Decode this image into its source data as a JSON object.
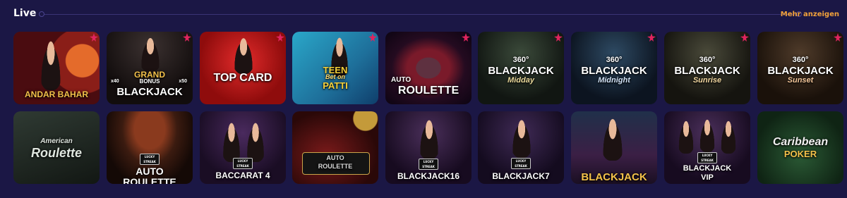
{
  "section": {
    "title": "Live",
    "more_label": "Mehr anzeigen"
  },
  "games": [
    {
      "name": "ANDAR BAHAR",
      "icon": "pin-icon",
      "style": "andar"
    },
    {
      "name": "GRAND BONUS BLACKJACK",
      "top": "GRAND",
      "mid": "BONUS",
      "bottom": "BLACKJACK",
      "mult_left": "x40",
      "mult_right": "x50",
      "style": "grand"
    },
    {
      "name": "TOP CARD",
      "style": "topcard"
    },
    {
      "name": "TEEN PATTI",
      "line1": "TEEN",
      "line2": "Bet on",
      "line3": "PATTI",
      "style": "teen"
    },
    {
      "name": "AUTO ROULETTE",
      "line1": "AUTO",
      "line2": "ROULETTE",
      "style": "autorou"
    },
    {
      "name": "360° BLACKJACK Midday",
      "deg": "360°",
      "main": "BLACKJACK",
      "sub": "Midday",
      "style": "bj1"
    },
    {
      "name": "360° BLACKJACK Midnight",
      "deg": "360°",
      "main": "BLACKJACK",
      "sub": "Midnight",
      "style": "bj2"
    },
    {
      "name": "360° BLACKJACK Sunrise",
      "deg": "360°",
      "main": "BLACKJACK",
      "sub": "Sunrise",
      "style": "bj3"
    },
    {
      "name": "360° BLACKJACK Sunset",
      "deg": "360°",
      "main": "BLACKJACK",
      "sub": "Sunset",
      "style": "bj4"
    },
    {
      "name": "American Roulette",
      "line1": "American",
      "line2": "Roulette",
      "style": "amer"
    },
    {
      "name": "LUCKY STREAK AUTO ROULETTE",
      "badge": "LUCKY STREAK",
      "line1": "AUTO",
      "line2": "ROULETTE",
      "style": "lsauto"
    },
    {
      "name": "LUCKY STREAK BACCARAT 4",
      "badge": "LUCKY STREAK",
      "line1": "BACCARAT 4",
      "style": "bacc"
    },
    {
      "name": "AUTO ROULETTE",
      "line1": "AUTO",
      "line2": "ROULETTE",
      "style": "autorou2"
    },
    {
      "name": "LUCKY STREAK BLACKJACK 16",
      "badge": "LUCKY STREAK",
      "line1": "BLACKJACK16",
      "style": "bj16"
    },
    {
      "name": "LUCKY STREAK BLACKJACK 7",
      "badge": "LUCKY STREAK",
      "line1": "BLACKJACK7",
      "style": "bj7"
    },
    {
      "name": "BLACKJACK",
      "line1": "BLACKJACK",
      "style": "bjplain"
    },
    {
      "name": "LUCKY STREAK BLACKJACK VIP",
      "badge": "LUCKY STREAK",
      "line1": "BLACKJACK",
      "line2": "VIP",
      "style": "bjvip"
    },
    {
      "name": "Caribbean Poker",
      "line1": "Caribbean",
      "line2": "POKER",
      "style": "carib"
    }
  ],
  "colors": {
    "background": "#1b1745",
    "accent": "#f2a23a",
    "pin": "#e0245e"
  }
}
